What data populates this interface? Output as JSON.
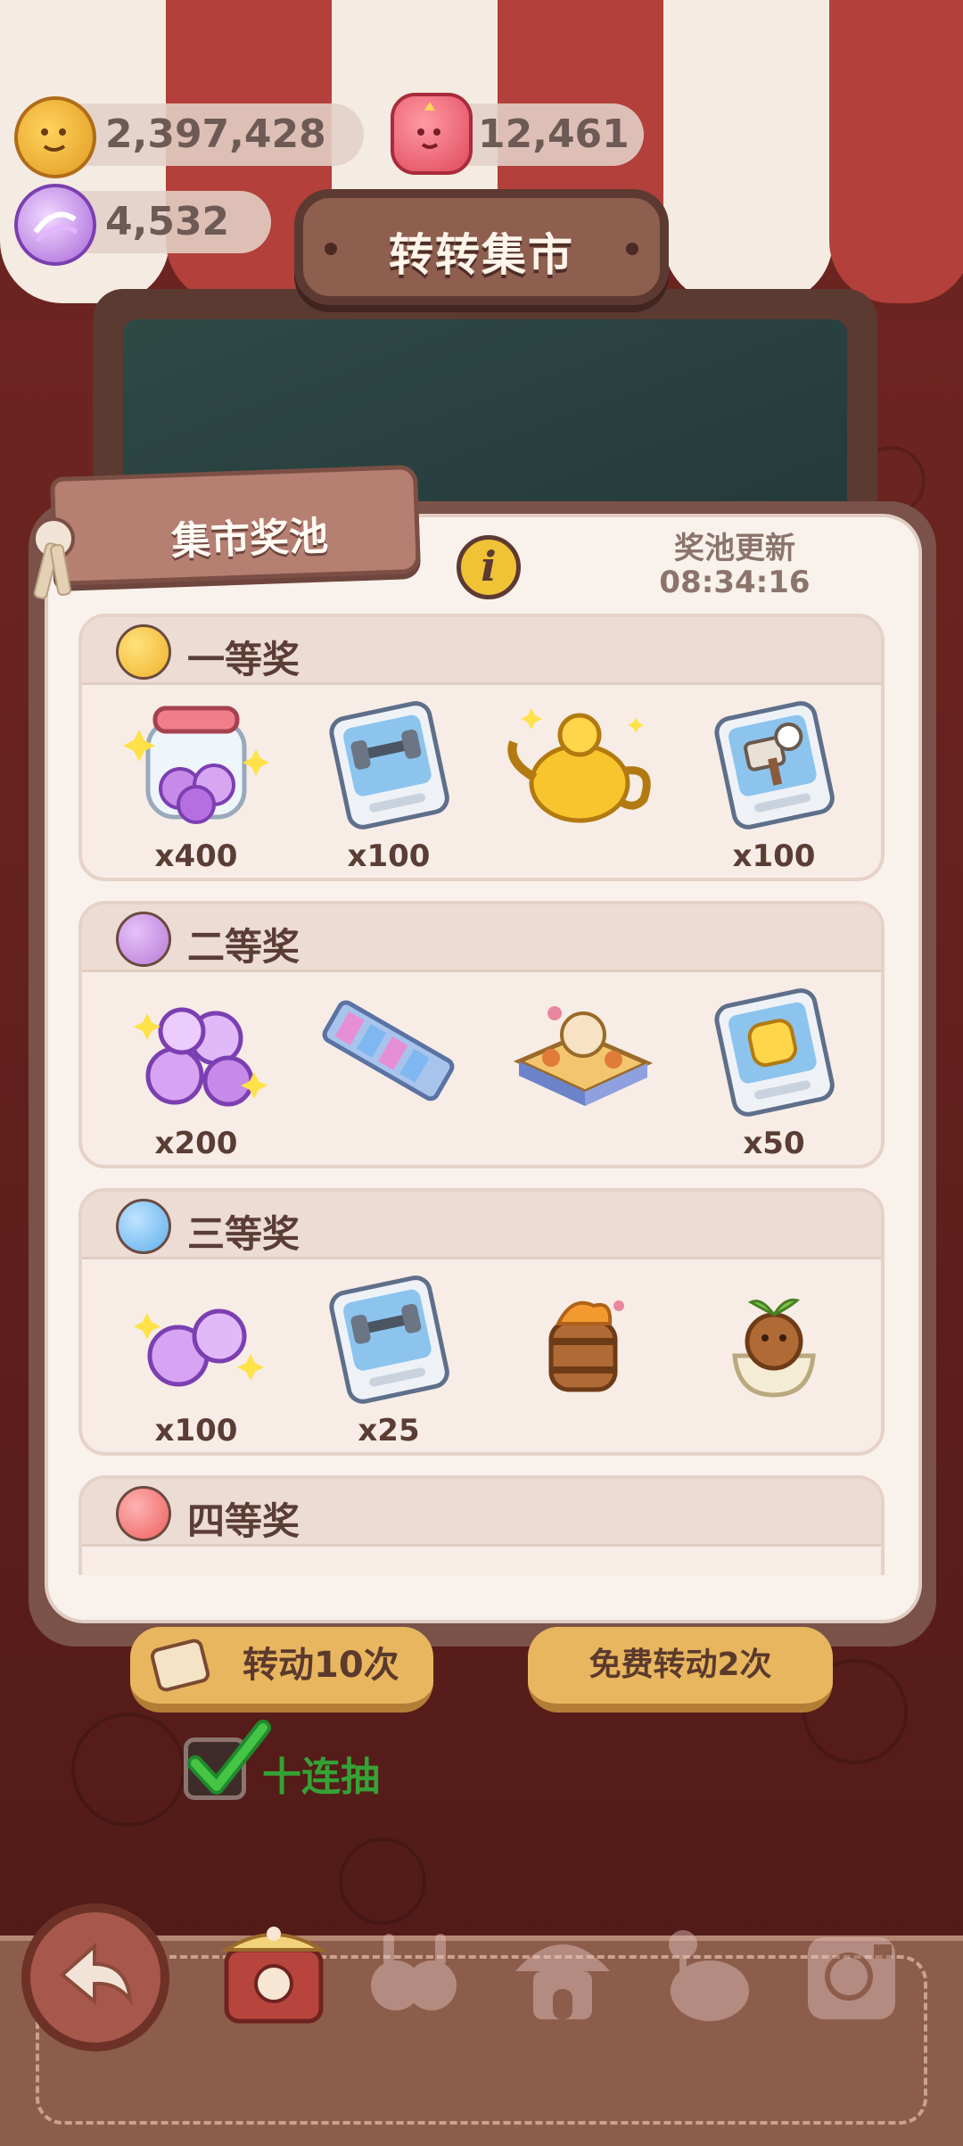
{
  "currencies": {
    "coins": {
      "icon": "cookie-coin-icon",
      "value": "2,397,428"
    },
    "hearts": {
      "icon": "pink-candy-icon",
      "value": "12,461"
    },
    "gems": {
      "icon": "purple-candy-icon",
      "value": "4,532"
    }
  },
  "title": "转转集市",
  "modal": {
    "tag_label": "集市奖池",
    "info_icon": "info-icon",
    "refresh_label": "奖池更新",
    "refresh_time": "08:34:16"
  },
  "sections": [
    {
      "title": "一等奖",
      "orb_color": "#f0b22e",
      "items": [
        {
          "icon": "candy-jar-icon",
          "qty": "x400"
        },
        {
          "icon": "dumbbell-card-icon",
          "qty": "x100"
        },
        {
          "icon": "golden-teapot-icon",
          "qty": ""
        },
        {
          "icon": "chef-card-icon",
          "qty": "x100"
        }
      ]
    },
    {
      "title": "二等奖",
      "orb_color": "#b77bd6",
      "items": [
        {
          "icon": "candy-pile-icon",
          "qty": "x200"
        },
        {
          "icon": "start-sign-icon",
          "qty": ""
        },
        {
          "icon": "food-table-icon",
          "qty": ""
        },
        {
          "icon": "fist-card-icon",
          "qty": "x50"
        }
      ]
    },
    {
      "title": "三等奖",
      "orb_color": "#5fb0ec",
      "items": [
        {
          "icon": "candy-bundle-icon",
          "qty": "x100"
        },
        {
          "icon": "dumbbell-card-icon",
          "qty": "x25"
        },
        {
          "icon": "barrel-icon",
          "qty": ""
        },
        {
          "icon": "plant-bear-icon",
          "qty": ""
        }
      ]
    },
    {
      "title": "四等奖",
      "orb_color": "#ee5f5f",
      "items": []
    }
  ],
  "buttons": {
    "spin10": {
      "icon": "ticket-icon",
      "label": "转动10次"
    },
    "free_spin": {
      "label": "免费转动2次"
    }
  },
  "ten_pull": {
    "label": "十连抽",
    "checked": true
  },
  "colors": {
    "accent_gold": "#e9b660",
    "check_green": "#35a235",
    "panel": "#f8f1ec"
  },
  "nav": [
    {
      "icon": "back-arrow-icon"
    },
    {
      "icon": "market-stall-icon"
    },
    {
      "icon": "bunny-friends-icon"
    },
    {
      "icon": "mushroom-house-icon"
    },
    {
      "icon": "teapot-chef-icon"
    },
    {
      "icon": "recycle-machine-icon"
    }
  ]
}
